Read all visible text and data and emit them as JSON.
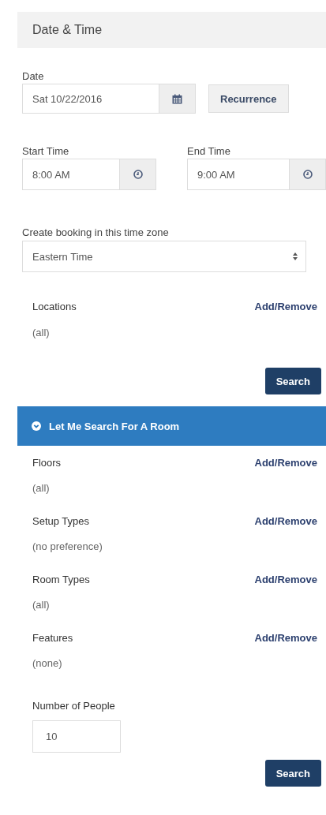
{
  "panel_title": "Date & Time",
  "date": {
    "label": "Date",
    "value": "Sat 10/22/2016",
    "recurrence_button": "Recurrence"
  },
  "times": [
    {
      "label": "Start Time",
      "value": "8:00 AM"
    },
    {
      "label": "End Time",
      "value": "9:00 AM"
    }
  ],
  "time_zone": {
    "label": "Create booking in this time zone",
    "value": "Eastern Time"
  },
  "locations": {
    "label": "Locations",
    "link": "Add/Remove",
    "value": "(all)"
  },
  "search_button": "Search",
  "room_search": {
    "title": "Let Me Search For A Room",
    "expanded": true,
    "filters": [
      {
        "label": "Floors",
        "link": "Add/Remove",
        "value": "(all)"
      },
      {
        "label": "Setup Types",
        "link": "Add/Remove",
        "value": "(no preference)"
      },
      {
        "label": "Room Types",
        "link": "Add/Remove",
        "value": "(all)"
      },
      {
        "label": "Features",
        "link": "Add/Remove",
        "value": "(none)"
      }
    ],
    "people": {
      "label": "Number of People",
      "value": "10"
    },
    "search_button": "Search"
  }
}
